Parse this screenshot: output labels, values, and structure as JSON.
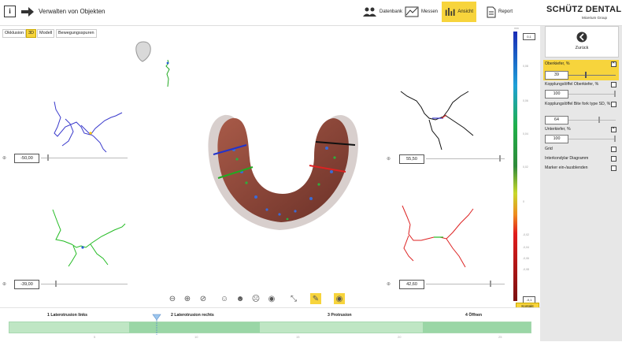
{
  "header": {
    "title": "Verwalten von Objekten",
    "tools": [
      {
        "label": "Datenbank",
        "icon": "people-icon",
        "active": false
      },
      {
        "label": "Messen",
        "icon": "measure-icon",
        "active": false
      },
      {
        "label": "Ansicht",
        "icon": "bar-chart-icon",
        "active": true
      },
      {
        "label": "Report",
        "icon": "document-icon",
        "active": false
      }
    ],
    "logo": "SCHÜTZ DENTAL",
    "logo_sub": "Micerium Group"
  },
  "view_tabs": [
    "Okklusion",
    "3D",
    "Modell",
    "Bewegungsspuren"
  ],
  "active_tab": "3D",
  "sliders": {
    "top_left": "-50,00",
    "bottom_left": "-39,00",
    "top_right": "55,50",
    "bottom_right": "42,60"
  },
  "scale": {
    "unit": "mm",
    "top_value": "0,1",
    "bottom_value": "-0,1",
    "button": "Kontakt",
    "ticks": [
      "0,1",
      "0,08",
      "0,06",
      "0,04",
      "0,02",
      "0",
      "-0,02",
      "-0,04",
      "-0,06",
      "-0,08",
      "-0,1"
    ]
  },
  "panel": {
    "back_label": "Zurück",
    "rows": [
      {
        "label": "Oberkiefer, %",
        "checked": true,
        "value": "39",
        "highlight": true
      },
      {
        "label": "Kopplungslöffel Oberkiefer, %",
        "checked": false,
        "value": "100"
      },
      {
        "label": "Kopplungslöffel Bite fork type SD, %",
        "checked": false,
        "value": "64"
      },
      {
        "label": "Unterkiefer, %",
        "checked": true,
        "value": "100"
      },
      {
        "label": "Grid",
        "checked": false
      },
      {
        "label": "Interkondylar Diagramm",
        "checked": false
      },
      {
        "label": "Marker ein-/ausblenden",
        "checked": false
      }
    ]
  },
  "timeline": {
    "phases": [
      "1 Laterotrusion links",
      "2 Laterotrusion rechts",
      "3 Protrusion",
      "4 Öffnen"
    ],
    "ticks": [
      "5",
      "10",
      "15",
      "20",
      "25"
    ]
  },
  "colors": {
    "accent": "#f7d43c",
    "track": "#bfe6c4",
    "track_dark": "#9ad6a6"
  }
}
